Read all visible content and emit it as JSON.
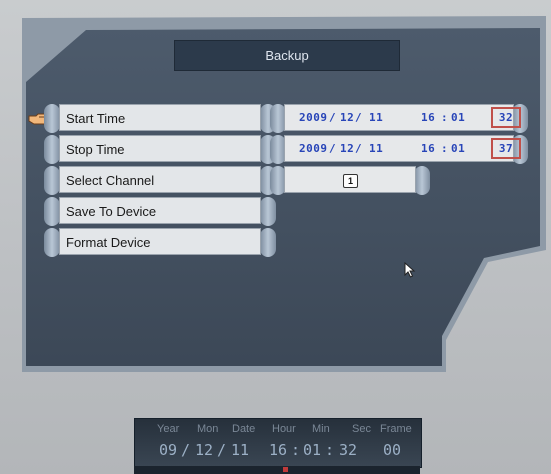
{
  "window": {
    "title": "Backup"
  },
  "menu": {
    "items": [
      {
        "label": "Start Time"
      },
      {
        "label": "Stop Time"
      },
      {
        "label": "Select Channel"
      },
      {
        "label": "Save To Device"
      },
      {
        "label": "Format Device"
      }
    ]
  },
  "start_time": {
    "year": "2009",
    "month": "12",
    "day": "11",
    "hour": "16",
    "minute": "01",
    "second": "32"
  },
  "stop_time": {
    "year": "2009",
    "month": "12",
    "day": "11",
    "hour": "16",
    "minute": "01",
    "second": "37"
  },
  "channel": {
    "value": "1"
  },
  "timebar": {
    "labels": {
      "year": "Year",
      "mon": "Mon",
      "date": "Date",
      "hour": "Hour",
      "min": "Min",
      "sec": "Sec",
      "frame": "Frame"
    },
    "values": {
      "year": "09",
      "mon": "12",
      "date": "11",
      "hour": "16",
      "min": "01",
      "sec": "32",
      "frame": "00"
    }
  },
  "colors": {
    "value_text": "#2845b8",
    "selected_border": "#c0504a",
    "panel": "#4a5869"
  },
  "icons": {
    "pointer": "hand-pointer-icon",
    "cursor": "mouse-cursor-icon"
  }
}
